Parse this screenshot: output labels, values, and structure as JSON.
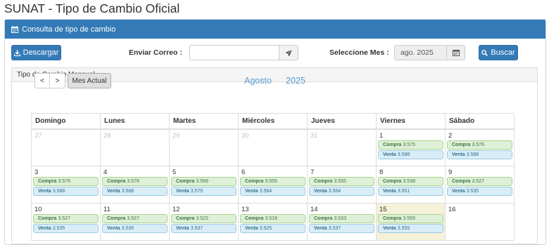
{
  "page": {
    "title": "SUNAT - Tipo de Cambio Oficial"
  },
  "panel": {
    "title": "Consulta de tipo de cambio"
  },
  "toolbar": {
    "download_label": "Descargar",
    "email_label": "Enviar Correo :",
    "email_value": "",
    "month_label": "Seleccione Mes :",
    "month_value": "ago. 2025",
    "search_label": "Buscar"
  },
  "calendar": {
    "section_title": "Tipo de Cambio Mensual",
    "prev_label": "<",
    "next_label": ">",
    "current_label": "Mes Actual",
    "month": "Agosto",
    "year": "2025",
    "weekdays": [
      "Domingo",
      "Lunes",
      "Martes",
      "Miércoles",
      "Jueves",
      "Viernes",
      "Sábado"
    ],
    "compra_label": "Compra",
    "venta_label": "Venta",
    "weeks": [
      [
        {
          "day": "27",
          "other": true
        },
        {
          "day": "28",
          "other": true
        },
        {
          "day": "29",
          "other": true
        },
        {
          "day": "30",
          "other": true
        },
        {
          "day": "31",
          "other": true
        },
        {
          "day": "1",
          "compra": "3.575",
          "venta": "3.588"
        },
        {
          "day": "2",
          "compra": "3.576",
          "venta": "3.588"
        }
      ],
      [
        {
          "day": "3",
          "compra": "3.576",
          "venta": "3.588"
        },
        {
          "day": "4",
          "compra": "3.576",
          "venta": "3.588"
        },
        {
          "day": "5",
          "compra": "3.566",
          "venta": "3.579"
        },
        {
          "day": "6",
          "compra": "3.555",
          "venta": "3.564"
        },
        {
          "day": "7",
          "compra": "3.555",
          "venta": "3.564"
        },
        {
          "day": "8",
          "compra": "3.538",
          "venta": "3.551"
        },
        {
          "day": "9",
          "compra": "3.527",
          "venta": "3.535"
        }
      ],
      [
        {
          "day": "10",
          "compra": "3.527",
          "venta": "3.535"
        },
        {
          "day": "11",
          "compra": "3.527",
          "venta": "3.535"
        },
        {
          "day": "12",
          "compra": "3.522",
          "venta": "3.537"
        },
        {
          "day": "13",
          "compra": "3.518",
          "venta": "3.525"
        },
        {
          "day": "14",
          "compra": "3.533",
          "venta": "3.537"
        },
        {
          "day": "15",
          "compra": "3.555",
          "venta": "3.555",
          "today": true
        },
        {
          "day": "16"
        }
      ]
    ]
  }
}
